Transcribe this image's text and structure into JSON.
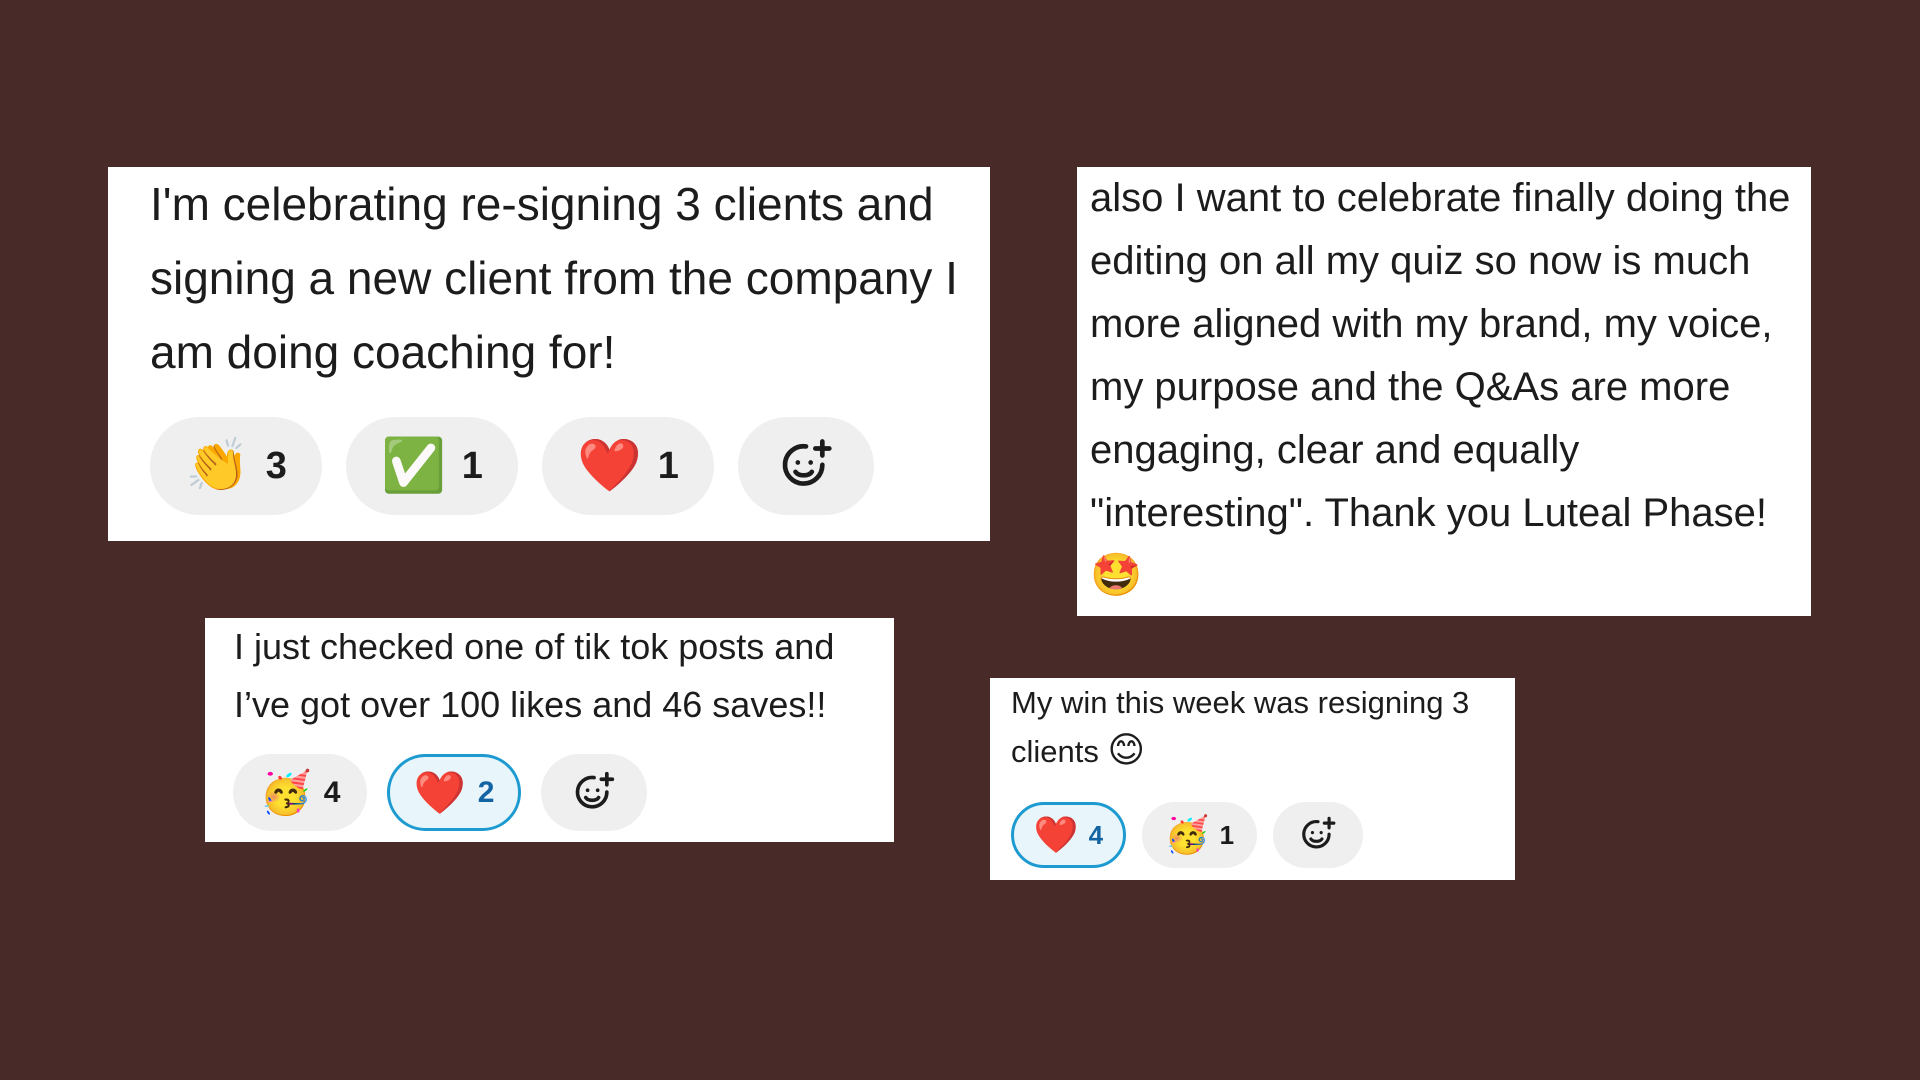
{
  "colors": {
    "background": "#482a28",
    "card": "#ffffff",
    "pill": "#efefef",
    "pill_active_border": "#1d9bd1",
    "pill_active_count": "#1264a3"
  },
  "messages": [
    {
      "text": "I'm celebrating re-signing 3 clients and signing a new client from the company I am doing coaching for!",
      "reactions": [
        {
          "emoji": "👏",
          "icon": "clapping-hands-icon",
          "count": "3",
          "active": false
        },
        {
          "emoji": "✅",
          "icon": "check-mark-button-icon",
          "count": "1",
          "active": false
        },
        {
          "emoji": "❤️",
          "icon": "red-heart-icon",
          "count": "1",
          "active": false
        }
      ],
      "add_reaction_icon": "add-reaction-icon"
    },
    {
      "text": "also I want to celebrate finally doing the editing on all my quiz so now is much more aligned with my brand, my voice, my purpose and the Q&As are more engaging, clear and equally \"interesting\". Thank you Luteal Phase!",
      "trailing_emoji": "🤩",
      "trailing_emoji_icon": "star-struck-icon"
    },
    {
      "text": "I just checked one of tik tok posts and I’ve got over 100 likes and 46 saves!!",
      "reactions": [
        {
          "emoji": "🥳",
          "icon": "partying-face-icon",
          "count": "4",
          "active": false
        },
        {
          "emoji": "❤️",
          "icon": "red-heart-icon",
          "count": "2",
          "active": true
        }
      ],
      "add_reaction_icon": "add-reaction-icon"
    },
    {
      "text": "My win this week was resigning 3 clients",
      "trailing_emoji": "😊",
      "trailing_emoji_icon": "smiling-face-icon",
      "reactions": [
        {
          "emoji": "❤️",
          "icon": "red-heart-icon",
          "count": "4",
          "active": true
        },
        {
          "emoji": "🥳",
          "icon": "partying-face-icon",
          "count": "1",
          "active": false
        }
      ],
      "add_reaction_icon": "add-reaction-icon"
    }
  ]
}
